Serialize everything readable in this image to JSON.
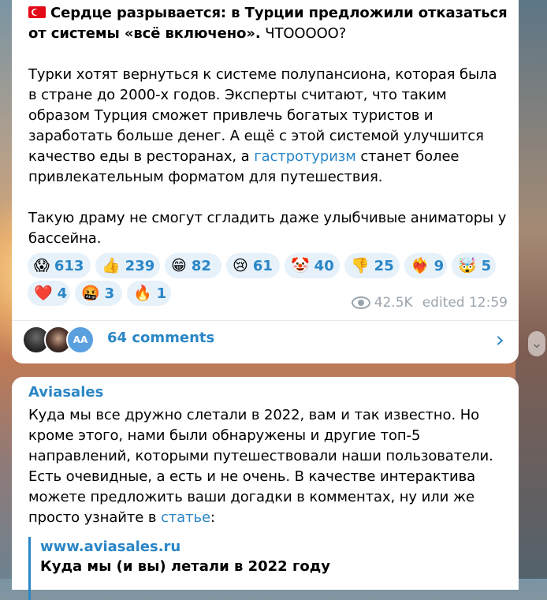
{
  "post1": {
    "title_bold": "Сердце разрывается: в Турции предложили отказаться от системы «всё включено».",
    "title_rest": " ЧТООООО?",
    "para1_a": "Турки хотят вернуться к системе полупансиона, которая была в стране до 2000-х годов. Эксперты считают, что таким образом Турция сможет привлечь богатых туристов и заработать больше денег. А ещё с этой системой улучшится качество еды в ресторанах, а ",
    "para1_link": "гастротуризм",
    "para1_b": " станет более привлекательным форматом для путешествия.",
    "para2": "Такую драму не смогут сгладить даже улыбчивые аниматоры у бассейна.",
    "reactions": [
      {
        "emoji": "😱",
        "count": "613"
      },
      {
        "emoji": "👍",
        "count": "239"
      },
      {
        "emoji": "😁",
        "count": "82"
      },
      {
        "emoji": "😢",
        "count": "61"
      },
      {
        "emoji": "🤡",
        "count": "40"
      },
      {
        "emoji": "👎",
        "count": "25"
      },
      {
        "emoji": "❤‍🔥",
        "count": "9"
      },
      {
        "emoji": "🤯",
        "count": "5"
      },
      {
        "emoji": "❤️",
        "count": "4"
      },
      {
        "emoji": "🤬",
        "count": "3"
      },
      {
        "emoji": "🔥",
        "count": "1"
      }
    ],
    "views": "42.5K",
    "edited": "edited 12:59",
    "comments_label": "64 comments",
    "avatar3_initials": "AA"
  },
  "post2": {
    "channel": "Aviasales",
    "text_a": "Куда мы все дружно слетали в 2022, вам и так известно. Но кроме этого, нами были обнаружены и другие топ-5 направлений, которыми путешествовали наши пользователи. Есть очевидные, а есть и не очень. В качестве интерактива можете предложить ваши догадки в комментах, ну или же просто узнайте в ",
    "text_link": "статье",
    "text_b": ":",
    "preview_site": "www.aviasales.ru",
    "preview_title": "Куда мы (и вы) летали в 2022 году"
  },
  "icons": {
    "flag": "turkey-flag-icon",
    "views": "eye-icon",
    "chevron": "chevron-right-icon",
    "scroll": "scroll-down-icon"
  }
}
